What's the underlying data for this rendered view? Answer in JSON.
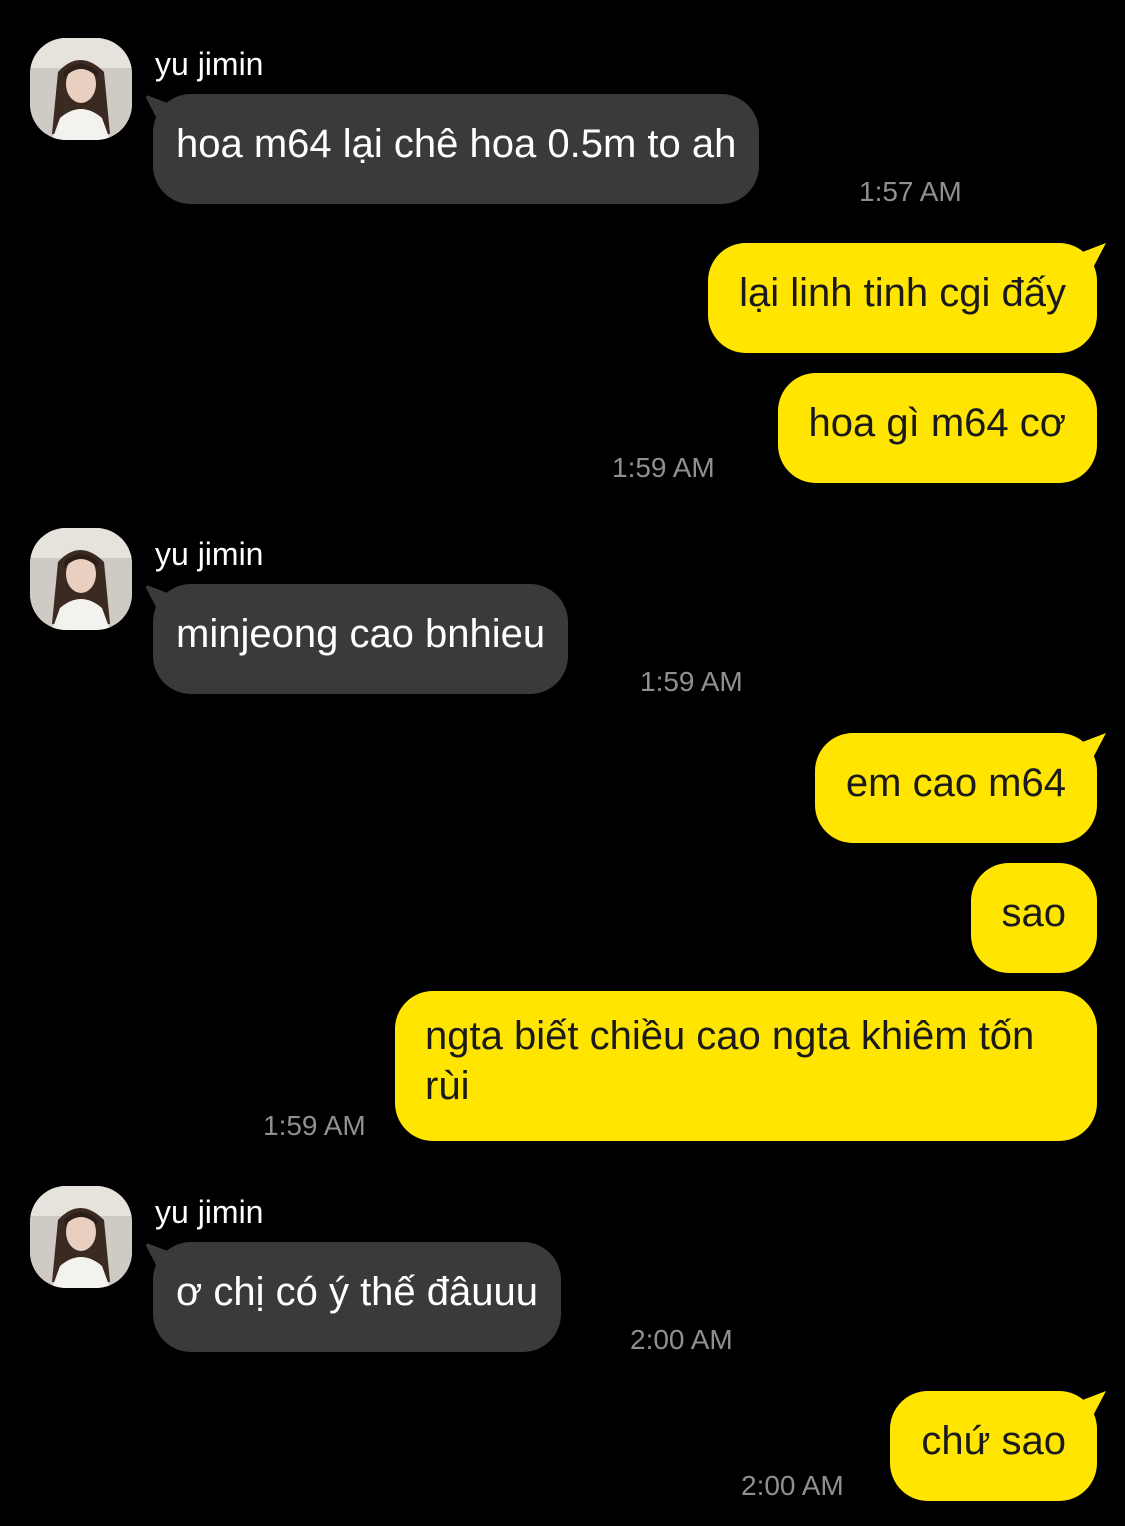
{
  "contact": {
    "name": "yu jimin"
  },
  "messages": [
    {
      "direction": "incoming",
      "text": "hoa m64 lại chê hoa 0.5m to ah",
      "time": "1:57 AM"
    },
    {
      "direction": "outgoing",
      "text": "lại linh tinh cgi đấy"
    },
    {
      "direction": "outgoing",
      "text": "hoa gì m64 cơ",
      "time": "1:59 AM"
    },
    {
      "direction": "incoming",
      "text": "minjeong cao bnhieu",
      "time": "1:59 AM"
    },
    {
      "direction": "outgoing",
      "text": "em cao m64"
    },
    {
      "direction": "outgoing",
      "text": "sao"
    },
    {
      "direction": "outgoing",
      "text": "ngta biết chiều cao ngta khiêm tốn rùi",
      "time": "1:59 AM"
    },
    {
      "direction": "incoming",
      "text": "ơ chị có ý thế đâuuu",
      "time": "2:00 AM"
    },
    {
      "direction": "outgoing",
      "text": "chứ sao",
      "time": "2:00 AM"
    }
  ],
  "colors": {
    "background": "#000000",
    "incoming_bubble": "#3a3a3c",
    "outgoing_bubble": "#ffe500",
    "timestamp": "#8e8e93"
  }
}
